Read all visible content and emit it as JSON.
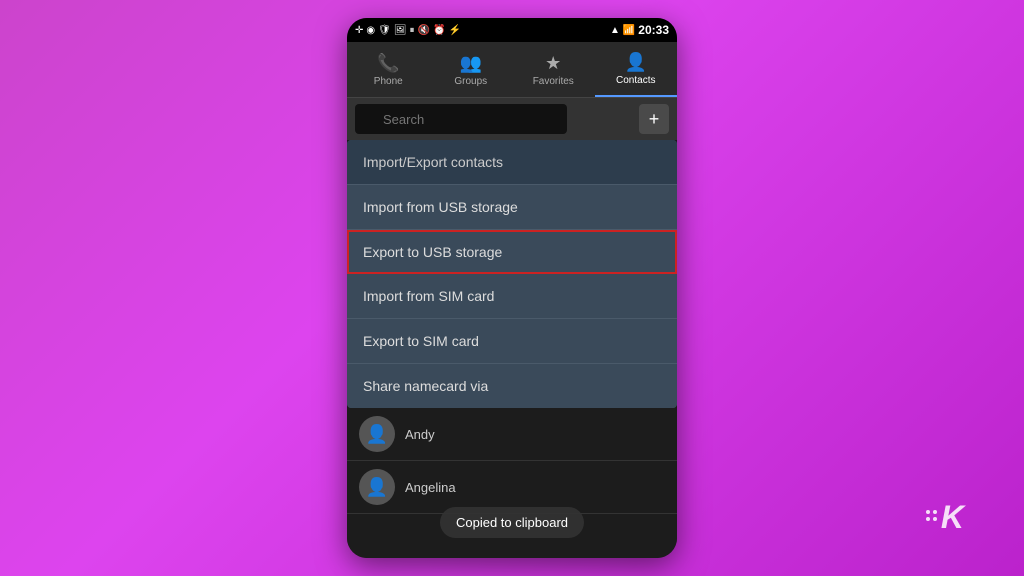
{
  "background": {
    "gradient_start": "#cc44cc",
    "gradient_end": "#bb22cc"
  },
  "status_bar": {
    "time": "20:33",
    "icons": [
      "notification",
      "wifi",
      "shield",
      "image",
      "pause",
      "mute",
      "alarm",
      "battery-charging",
      "signal",
      "signal-bars",
      "battery"
    ]
  },
  "nav_tabs": [
    {
      "label": "Phone",
      "icon": "📞",
      "active": false
    },
    {
      "label": "Groups",
      "icon": "👥",
      "active": false
    },
    {
      "label": "Favorites",
      "icon": "★",
      "active": false
    },
    {
      "label": "Contacts",
      "icon": "👤",
      "active": true
    }
  ],
  "search": {
    "placeholder": "Search",
    "add_button_label": "+"
  },
  "dropdown": {
    "header": "Import/Export contacts",
    "items": [
      {
        "label": "Import from USB storage",
        "selected": false
      },
      {
        "label": "Export to USB storage",
        "selected": true
      },
      {
        "label": "Import from SIM card",
        "selected": false
      },
      {
        "label": "Export to SIM card",
        "selected": false
      },
      {
        "label": "Share namecard via",
        "selected": false
      }
    ]
  },
  "contacts": [
    {
      "name": "Andy"
    },
    {
      "name": "Angelina"
    }
  ],
  "toast": {
    "message": "Copied to clipboard"
  },
  "watermark": {
    "letter": "K"
  }
}
